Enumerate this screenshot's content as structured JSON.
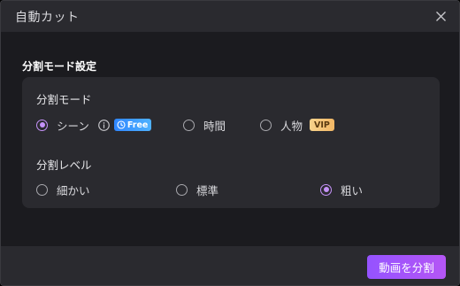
{
  "dialog": {
    "title": "自動カット",
    "close_icon": "close-icon"
  },
  "settings": {
    "heading": "分割モード設定",
    "split_mode": {
      "label": "分割モード",
      "options": [
        {
          "label": "シーン",
          "selected": true,
          "badge": "Free",
          "badge_icon": "clock-icon",
          "info_icon": "info-icon"
        },
        {
          "label": "時間",
          "selected": false
        },
        {
          "label": "人物",
          "selected": false,
          "badge": "VIP"
        }
      ]
    },
    "split_level": {
      "label": "分割レベル",
      "options": [
        {
          "label": "細かい",
          "selected": false
        },
        {
          "label": "標準",
          "selected": false
        },
        {
          "label": "粗い",
          "selected": true
        }
      ]
    }
  },
  "footer": {
    "action_label": "動画を分割"
  },
  "colors": {
    "accent": "#c592f8",
    "button_gradient_start": "#9553ff",
    "button_gradient_end": "#b556f5",
    "free_badge": "#2f86ff",
    "vip_badge": "#f2b765"
  }
}
